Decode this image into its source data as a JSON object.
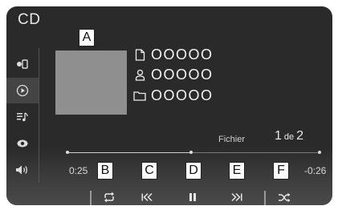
{
  "header": {
    "title": "CD"
  },
  "sidebar": {
    "items": [
      "device-source-icon",
      "play-circle-icon",
      "playlist-music-icon",
      "eye-icon",
      "volume-icon"
    ]
  },
  "track_info": {
    "file": "OOOOO",
    "artist": "OOOOO",
    "folder": "OOOOO"
  },
  "playback": {
    "fichier_label": "Fichier",
    "track_current": "1",
    "track_of": "de",
    "track_total": "2",
    "elapsed": "0:25",
    "remaining": "-0:26",
    "progress_fraction": 0.49
  },
  "controls": [
    "repeat",
    "previous",
    "pause",
    "next",
    "shuffle"
  ],
  "callouts": {
    "a": "A",
    "b": "B",
    "c": "C",
    "d": "D",
    "e": "E",
    "f": "F"
  },
  "colors": {
    "screen_bg": "#2a2a2a",
    "text": "#f2f2f2",
    "album_art": "#8f8f8f"
  }
}
